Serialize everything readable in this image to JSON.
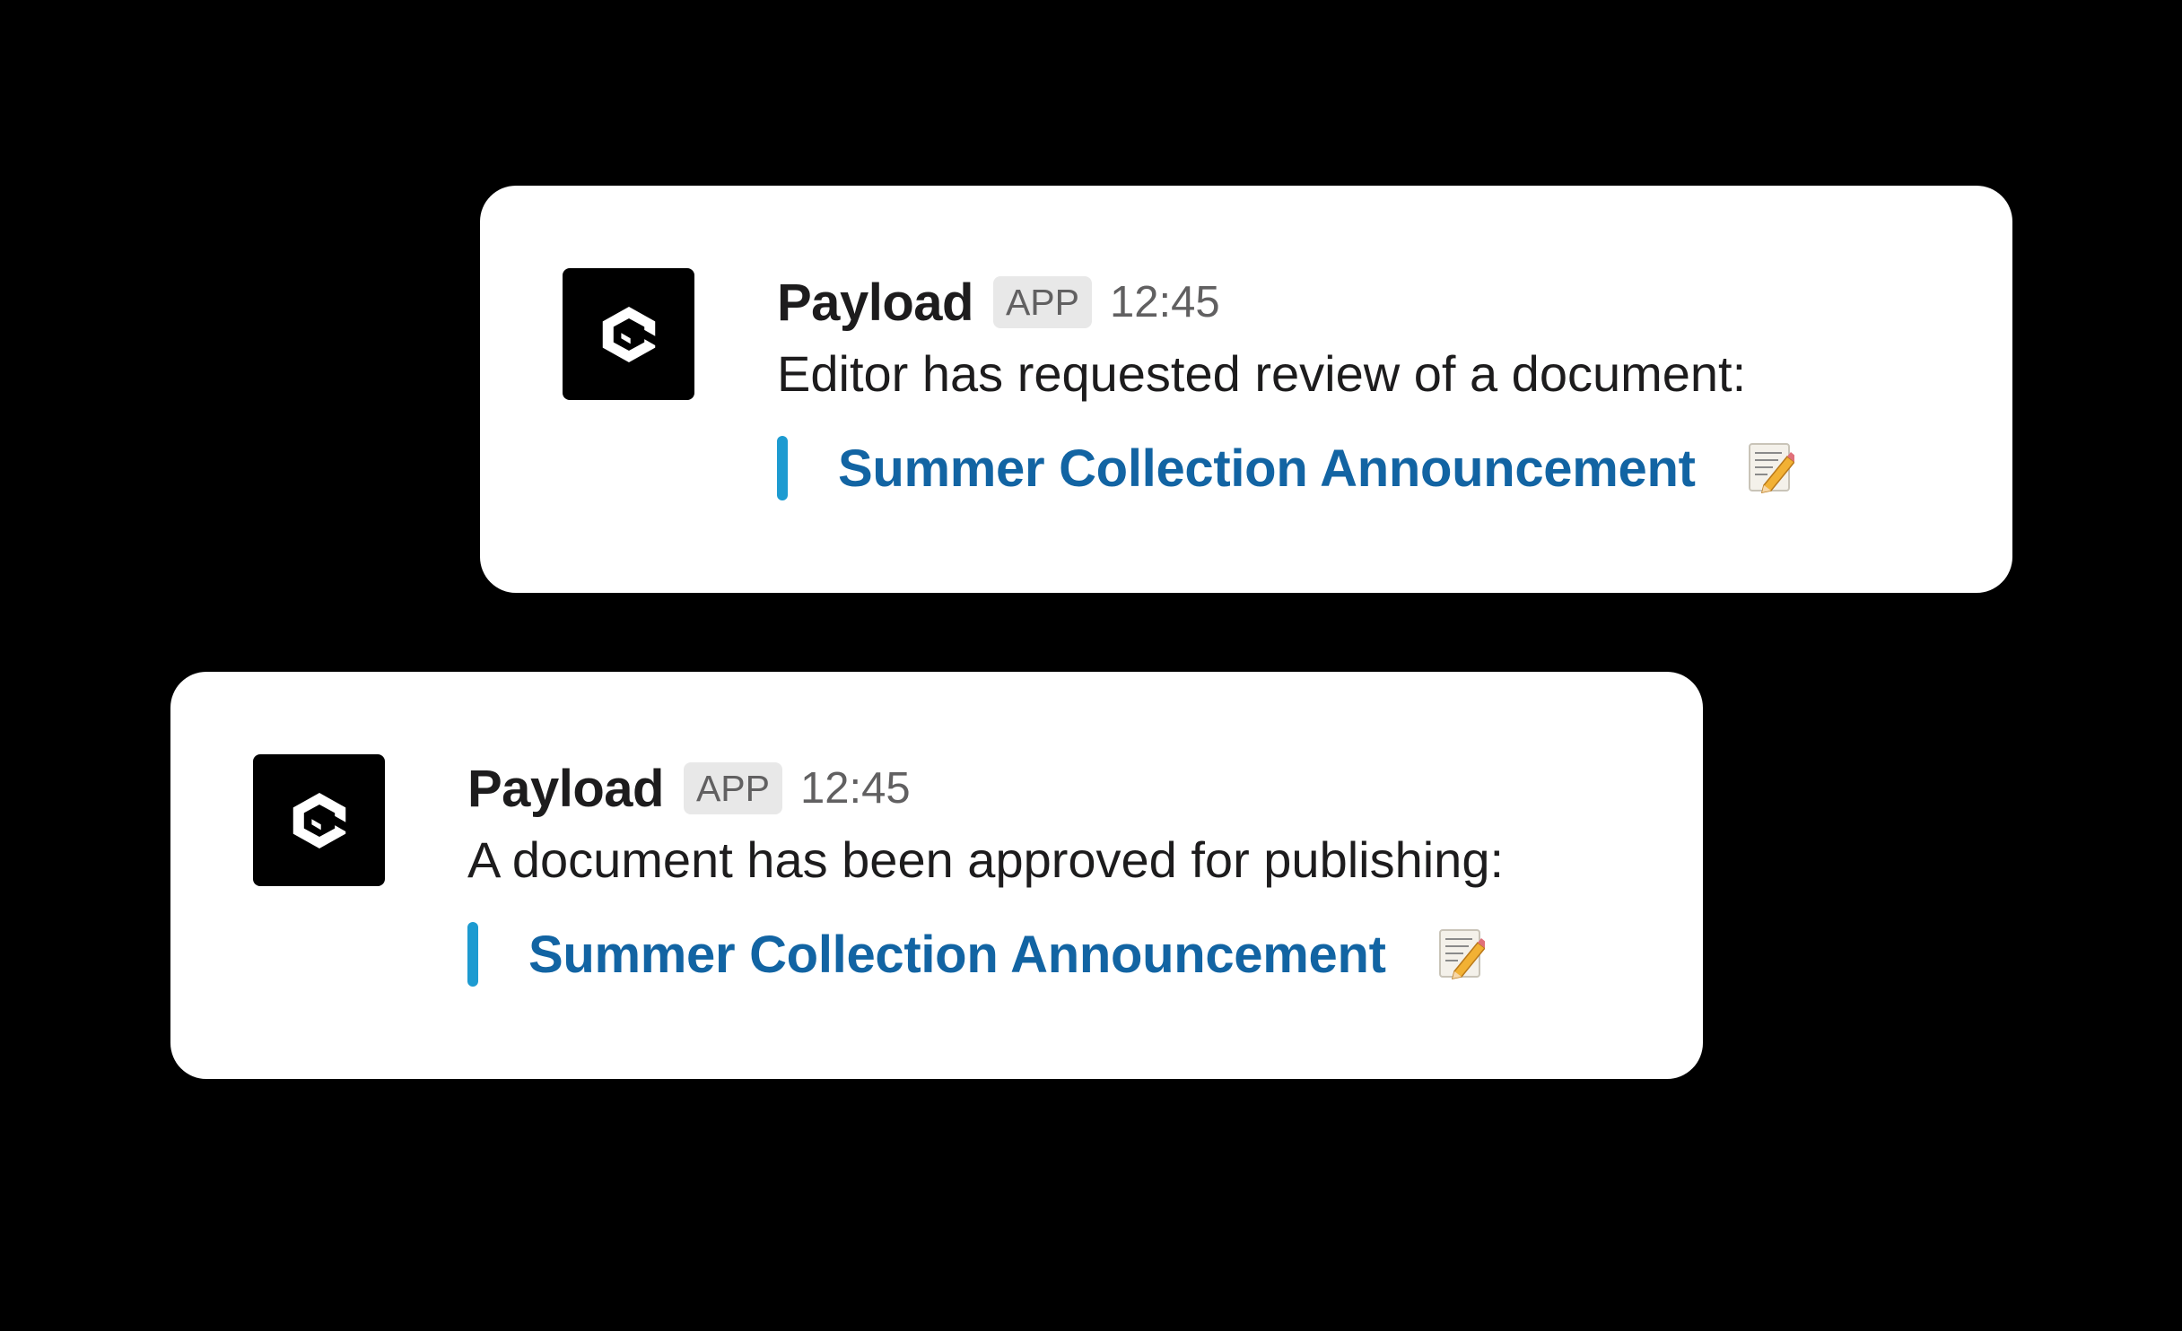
{
  "colors": {
    "background": "#000000",
    "card": "#ffffff",
    "link": "#1264a3",
    "quote_bar": "#1d9bd1",
    "badge_bg": "#e8e8e8"
  },
  "messages": [
    {
      "avatar_icon": "payload-logo-icon",
      "sender": "Payload",
      "badge": "APP",
      "time": "12:45",
      "text": "Editor has requested review of a document:",
      "attachment": {
        "title": "Summer Collection Announcement",
        "emoji_icon": "memo-icon"
      }
    },
    {
      "avatar_icon": "payload-logo-icon",
      "sender": "Payload",
      "badge": "APP",
      "time": "12:45",
      "text": "A document has been approved for publishing:",
      "attachment": {
        "title": "Summer Collection Announcement",
        "emoji_icon": "memo-icon"
      }
    }
  ]
}
